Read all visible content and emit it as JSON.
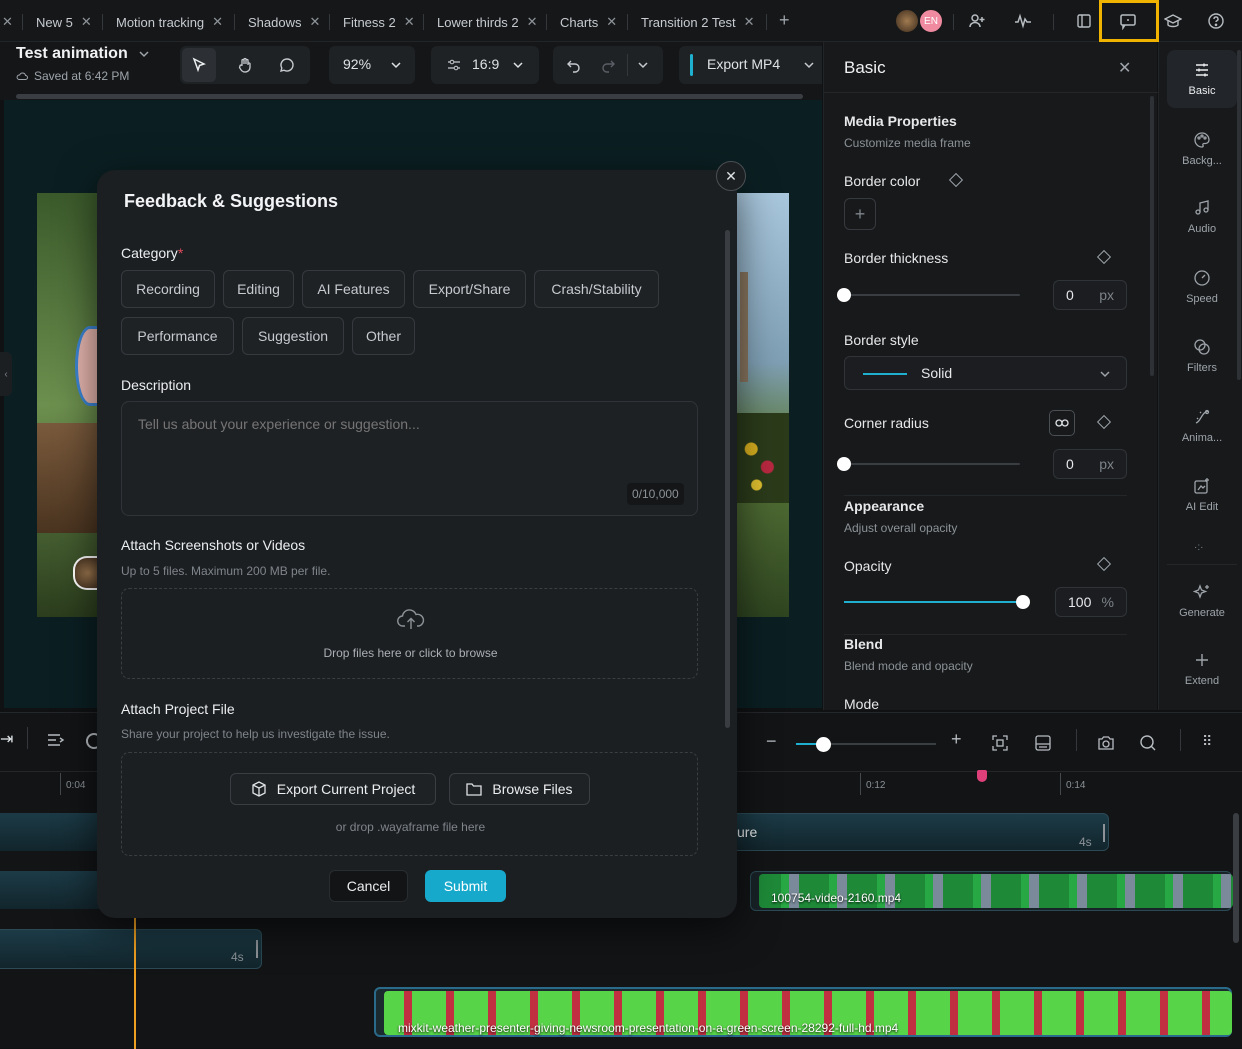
{
  "tabs": [
    {
      "label": "New 5"
    },
    {
      "label": "Motion tracking"
    },
    {
      "label": "Shadows"
    },
    {
      "label": "Fitness 2"
    },
    {
      "label": "Lower thirds 2"
    },
    {
      "label": "Charts"
    },
    {
      "label": "Transition 2 Test"
    }
  ],
  "topbar": {
    "avatar_initials": "EN"
  },
  "project": {
    "title": "Test animation",
    "saved": "Saved at 6:42 PM"
  },
  "toolbar": {
    "zoom": "92%",
    "aspect": "16:9",
    "export_label": "Export MP4"
  },
  "panel": {
    "title": "Basic",
    "media_title": "Media Properties",
    "media_sub": "Customize media frame",
    "border_color": "Border color",
    "border_thickness": "Border thickness",
    "border_thickness_value": "0",
    "unit_px": "px",
    "border_style": "Border style",
    "border_style_value": "Solid",
    "corner_radius": "Corner radius",
    "corner_radius_value": "0",
    "appearance_title": "Appearance",
    "appearance_sub": "Adjust overall opacity",
    "opacity": "Opacity",
    "opacity_value": "100",
    "unit_pct": "%",
    "opacity_level": 1.0,
    "blend_title": "Blend",
    "blend_sub": "Blend mode and opacity",
    "mode": "Mode"
  },
  "rail": [
    {
      "label": "Basic",
      "icon": "sliders-icon"
    },
    {
      "label": "Backg...",
      "icon": "palette-icon"
    },
    {
      "label": "Audio",
      "icon": "music-icon"
    },
    {
      "label": "Speed",
      "icon": "speedometer-icon"
    },
    {
      "label": "Filters",
      "icon": "filters-icon"
    },
    {
      "label": "Anima...",
      "icon": "animation-icon"
    },
    {
      "label": "AI Edit",
      "icon": "ai-edit-icon"
    },
    {
      "label": "Generate",
      "icon": "sparkles-icon"
    },
    {
      "label": "Extend",
      "icon": "plus-icon"
    }
  ],
  "timeline": {
    "ticks": [
      "0:04",
      "0:12",
      "0:14"
    ],
    "clip_text_ure": "ure",
    "dur_4s": "4s",
    "clip_video_1": "100754-video-2160.mp4",
    "clip_video_2": "mixkit-weather-presenter-giving-newsroom-presentation-on-a-green-screen-28292-full-hd.mp4"
  },
  "modal": {
    "title": "Feedback & Suggestions",
    "category_label": "Category",
    "required_mark": "*",
    "categories": [
      "Recording",
      "Editing",
      "AI Features",
      "Export/Share",
      "Crash/Stability",
      "Performance",
      "Suggestion",
      "Other"
    ],
    "description_label": "Description",
    "description_placeholder": "Tell us about your experience or suggestion...",
    "char_count": "0/10,000",
    "attach_title": "Attach Screenshots or Videos",
    "attach_sub": "Up to 5 files. Maximum 200 MB per file.",
    "drop_text": "Drop files here or click to browse",
    "project_title": "Attach Project File",
    "project_sub": "Share your project to help us investigate the issue.",
    "export_button": "Export Current Project",
    "browse_button": "Browse Files",
    "drop_project": "or drop .wayaframe file here",
    "cancel": "Cancel",
    "submit": "Submit"
  },
  "colors": {
    "accent": "#1fb0d0",
    "highlight": "#f0b400",
    "green_clip": "#2db84a"
  }
}
